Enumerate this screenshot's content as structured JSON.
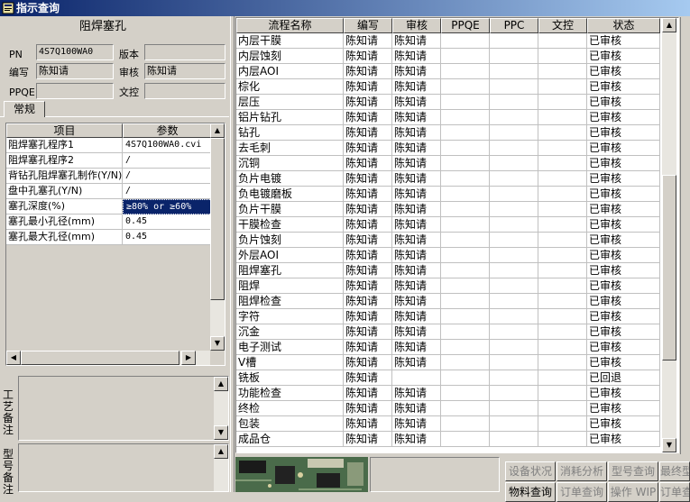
{
  "window": {
    "title": "指示查询"
  },
  "left": {
    "process_title": "阻焊塞孔",
    "fields": {
      "pn_label": "PN",
      "pn_value": "4S7Q100WA0",
      "version_label": "版本",
      "version_value": "",
      "author_label": "编写",
      "author_value": "陈知请",
      "reviewer_label": "审核",
      "reviewer_value": "陈知请",
      "ppqe_label": "PPQE",
      "ppqe_value": "",
      "doc_label": "文控",
      "doc_value": ""
    },
    "tab_label": "常规",
    "param_table": {
      "headers": [
        "项目",
        "参数"
      ],
      "rows": [
        [
          "阻焊塞孔程序1",
          "4S7Q100WA0.cvi"
        ],
        [
          "阻焊塞孔程序2",
          "/"
        ],
        [
          "背钻孔阻焊塞孔制作(Y/N)",
          "/"
        ],
        [
          "盘中孔塞孔(Y/N)",
          "/"
        ],
        [
          "塞孔深度(%)",
          "≥80% or ≥60%"
        ],
        [
          "塞孔最小孔径(mm)",
          "0.45"
        ],
        [
          "塞孔最大孔径(mm)",
          "0.45"
        ]
      ],
      "selected_row": 4
    },
    "note1_label": "工艺备注",
    "note2_label": "型号备注"
  },
  "grid": {
    "headers": [
      "流程名称",
      "编写",
      "审核",
      "PPQE",
      "PPC",
      "文控",
      "状态"
    ],
    "rows": [
      [
        "内层干膜",
        "陈知请",
        "陈知请",
        "",
        "",
        "",
        "已审核"
      ],
      [
        "内层蚀刻",
        "陈知请",
        "陈知请",
        "",
        "",
        "",
        "已审核"
      ],
      [
        "内层AOI",
        "陈知请",
        "陈知请",
        "",
        "",
        "",
        "已审核"
      ],
      [
        "棕化",
        "陈知请",
        "陈知请",
        "",
        "",
        "",
        "已审核"
      ],
      [
        "层压",
        "陈知请",
        "陈知请",
        "",
        "",
        "",
        "已审核"
      ],
      [
        "铝片钻孔",
        "陈知请",
        "陈知请",
        "",
        "",
        "",
        "已审核"
      ],
      [
        "钻孔",
        "陈知请",
        "陈知请",
        "",
        "",
        "",
        "已审核"
      ],
      [
        "去毛刺",
        "陈知请",
        "陈知请",
        "",
        "",
        "",
        "已审核"
      ],
      [
        "沉铜",
        "陈知请",
        "陈知请",
        "",
        "",
        "",
        "已审核"
      ],
      [
        "负片电镀",
        "陈知请",
        "陈知请",
        "",
        "",
        "",
        "已审核"
      ],
      [
        "负电镀磨板",
        "陈知请",
        "陈知请",
        "",
        "",
        "",
        "已审核"
      ],
      [
        "负片干膜",
        "陈知请",
        "陈知请",
        "",
        "",
        "",
        "已审核"
      ],
      [
        "干膜检查",
        "陈知请",
        "陈知请",
        "",
        "",
        "",
        "已审核"
      ],
      [
        "负片蚀刻",
        "陈知请",
        "陈知请",
        "",
        "",
        "",
        "已审核"
      ],
      [
        "外层AOI",
        "陈知请",
        "陈知请",
        "",
        "",
        "",
        "已审核"
      ],
      [
        "阻焊塞孔",
        "陈知请",
        "陈知请",
        "",
        "",
        "",
        "已审核"
      ],
      [
        "阻焊",
        "陈知请",
        "陈知请",
        "",
        "",
        "",
        "已审核"
      ],
      [
        "阻焊检查",
        "陈知请",
        "陈知请",
        "",
        "",
        "",
        "已审核"
      ],
      [
        "字符",
        "陈知请",
        "陈知请",
        "",
        "",
        "",
        "已审核"
      ],
      [
        "沉金",
        "陈知请",
        "陈知请",
        "",
        "",
        "",
        "已审核"
      ],
      [
        "电子测试",
        "陈知请",
        "陈知请",
        "",
        "",
        "",
        "已审核"
      ],
      [
        "V槽",
        "陈知请",
        "陈知请",
        "",
        "",
        "",
        "已审核"
      ],
      [
        "铣板",
        "陈知请",
        "",
        "",
        "",
        "",
        "已回退"
      ],
      [
        "功能检查",
        "陈知请",
        "陈知请",
        "",
        "",
        "",
        "已审核"
      ],
      [
        "终检",
        "陈知请",
        "陈知请",
        "",
        "",
        "",
        "已审核"
      ],
      [
        "包装",
        "陈知请",
        "陈知请",
        "",
        "",
        "",
        "已审核"
      ],
      [
        "成品仓",
        "陈知请",
        "陈知请",
        "",
        "",
        "",
        "已审核"
      ]
    ]
  },
  "bottom_buttons": {
    "row1": [
      "设备状况",
      "消耗分析",
      "型号查询",
      "最终型"
    ],
    "row2": [
      "物料查询",
      "订单查询",
      "操作 WIP",
      "订单查"
    ]
  },
  "colors": {
    "title_bar_start": "#0a246a",
    "title_bar_end": "#a6caf0",
    "window_face": "#d4d0c8",
    "selection": "#0a246a"
  }
}
